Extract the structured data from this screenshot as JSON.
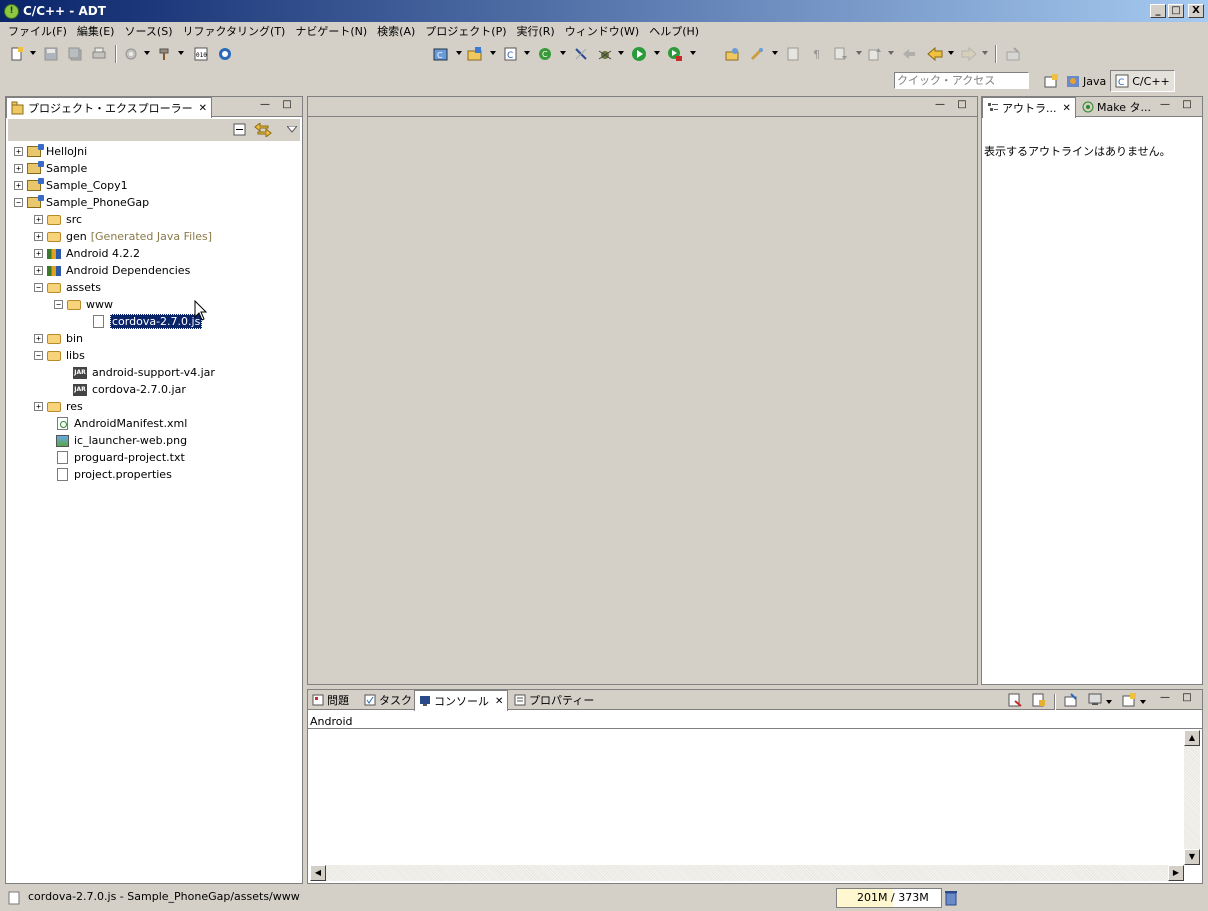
{
  "window": {
    "title": "C/C++ - ADT",
    "minimize": "_",
    "maximize": "□",
    "close": "X"
  },
  "menu": [
    "ファイル(F)",
    "編集(E)",
    "ソース(S)",
    "リファクタリング(T)",
    "ナビゲート(N)",
    "検索(A)",
    "プロジェクト(P)",
    "実行(R)",
    "ウィンドウ(W)",
    "ヘルプ(H)"
  ],
  "quick_access": {
    "placeholder": "クイック・アクセス"
  },
  "perspectives": {
    "java": "Java",
    "cpp": "C/C++"
  },
  "explorer": {
    "tab": "プロジェクト・エクスプローラー",
    "tree": [
      {
        "label": "HelloJni"
      },
      {
        "label": "Sample"
      },
      {
        "label": "Sample_Copy1"
      },
      {
        "label": "Sample_PhoneGap"
      },
      {
        "label": "src"
      },
      {
        "label": "gen",
        "decoration": "[Generated Java Files]"
      },
      {
        "label": "Android 4.2.2"
      },
      {
        "label": "Android Dependencies"
      },
      {
        "label": "assets"
      },
      {
        "label": "www"
      },
      {
        "label": "cordova-2.7.0.js"
      },
      {
        "label": "bin"
      },
      {
        "label": "libs"
      },
      {
        "label": "android-support-v4.jar"
      },
      {
        "label": "cordova-2.7.0.jar"
      },
      {
        "label": "res"
      },
      {
        "label": "AndroidManifest.xml"
      },
      {
        "label": "ic_launcher-web.png"
      },
      {
        "label": "proguard-project.txt"
      },
      {
        "label": "project.properties"
      }
    ]
  },
  "outline": {
    "tabs": [
      "アウトラ...",
      "Make タ..."
    ],
    "message": "表示するアウトラインはありません。"
  },
  "console": {
    "tabs": [
      "問題",
      "タスク",
      "コンソール",
      "プロパティー"
    ],
    "label": "Android"
  },
  "status": {
    "text": "cordova-2.7.0.js - Sample_PhoneGap/assets/www",
    "heap_used": "201M",
    "heap_total": "373M"
  }
}
